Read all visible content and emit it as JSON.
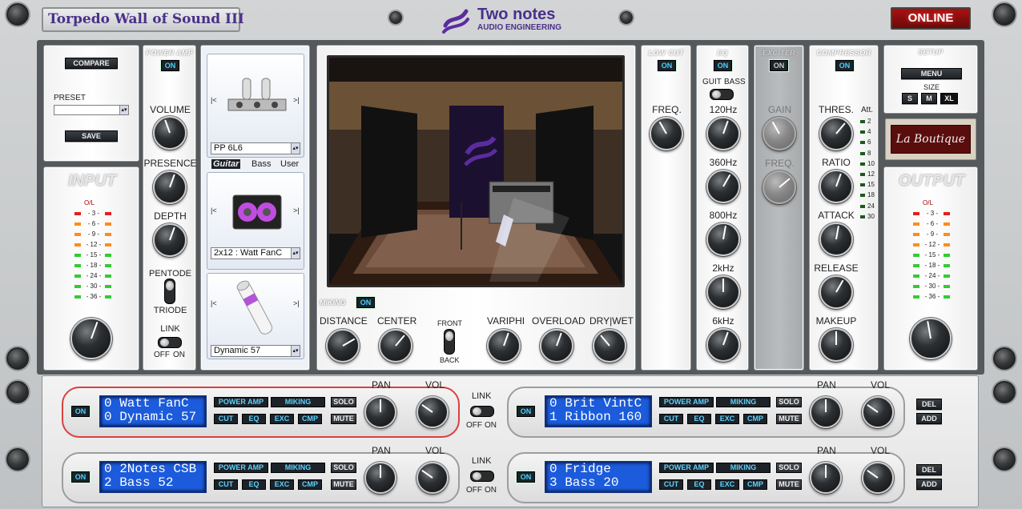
{
  "app": {
    "title": "Torpedo Wall of Sound III",
    "brand_line1": "Two notes",
    "brand_line2": "AUDIO ENGINEERING",
    "status": "ONLINE"
  },
  "colors": {
    "accent_blue": "#4ad2ff",
    "lcd_blue": "#1b5bdc",
    "online_red": "#c81e1e",
    "brand_purple": "#5b2ca0",
    "led_green": "#33cc33",
    "led_orange": "#ff8c1a",
    "led_red": "#e02020"
  },
  "preset": {
    "compare_label": "COMPARE",
    "preset_label": "PRESET",
    "preset_value": "",
    "save_label": "SAVE"
  },
  "input": {
    "title": "INPUT",
    "ol": "O/L",
    "scale": [
      "- 3 -",
      "- 6 -",
      "- 9 -",
      "- 12 -",
      "- 15 -",
      "- 18 -",
      "- 24 -",
      "- 30 -",
      "- 36 -"
    ]
  },
  "output": {
    "title": "OUTPUT",
    "ol": "O/L",
    "scale": [
      "- 3 -",
      "- 6 -",
      "- 9 -",
      "- 12 -",
      "- 15 -",
      "- 18 -",
      "- 24 -",
      "- 30 -",
      "- 36 -"
    ]
  },
  "power_amp": {
    "title": "POWER AMP",
    "on": "ON",
    "volume": "VOLUME",
    "presence": "PRESENCE",
    "depth": "DEPTH",
    "pentode": "PENTODE",
    "triode": "TRIODE",
    "link": "LINK",
    "off": "OFF",
    "on2": "ON"
  },
  "selectors": {
    "amp": {
      "value": "PP 6L6",
      "prev": "|<",
      "next": ">|"
    },
    "cab_tabs": [
      "Guitar",
      "Bass",
      "User"
    ],
    "cab": {
      "value": "2x12 : Watt FanC",
      "prev": "|<",
      "next": ">|"
    },
    "mic": {
      "value": "Dynamic 57",
      "prev": "|<",
      "next": ">|"
    }
  },
  "miking": {
    "title": "MIKING",
    "on": "ON",
    "distance": "DISTANCE",
    "center": "CENTER",
    "front": "FRONT",
    "back": "BACK",
    "variphi": "VARIPHI",
    "overload": "OVERLOAD",
    "drywet": "DRY|WET"
  },
  "low_cut": {
    "title": "LOW CUT",
    "on": "ON",
    "freq": "FREQ."
  },
  "eq": {
    "title": "EQ",
    "on": "ON",
    "guit": "GUIT",
    "bass": "BASS",
    "bands": [
      "120Hz",
      "360Hz",
      "800Hz",
      "2kHz",
      "6kHz"
    ]
  },
  "exciter": {
    "title": "EXCITER",
    "on": "ON",
    "gain": "GAIN",
    "freq": "FREQ."
  },
  "compressor": {
    "title": "COMPRESSOR",
    "on": "ON",
    "thres": "THRES.",
    "ratio": "RATIO",
    "attack": "ATTACK",
    "release": "RELEASE",
    "makeup": "MAKEUP",
    "att": "Att.",
    "att_scale": [
      "2",
      "4",
      "6",
      "8",
      "10",
      "12",
      "15",
      "18",
      "24",
      "30"
    ]
  },
  "setup": {
    "title": "SETUP",
    "menu": "MENU",
    "size": "SIZE",
    "sizes": [
      "S",
      "M",
      "XL"
    ],
    "logo": "La Boutique"
  },
  "slots": [
    {
      "on": "ON",
      "line1": "0 Watt FanC",
      "line2": "0 Dynamic 57",
      "power_amp": "POWER AMP",
      "miking": "MIKING",
      "solo": "SOLO",
      "cut": "CUT",
      "eq": "EQ",
      "exc": "EXC",
      "cmp": "CMP",
      "mute": "MUTE",
      "pan": "PAN",
      "vol": "VOL"
    },
    {
      "on": "ON",
      "line1": "0 Brit VintC",
      "line2": "1 Ribbon 160",
      "power_amp": "POWER AMP",
      "miking": "MIKING",
      "solo": "SOLO",
      "cut": "CUT",
      "eq": "EQ",
      "exc": "EXC",
      "cmp": "CMP",
      "mute": "MUTE",
      "pan": "PAN",
      "vol": "VOL",
      "del": "DEL",
      "add": "ADD"
    },
    {
      "on": "ON",
      "line1": "0 2Notes CSB",
      "line2": "2 Bass 52",
      "power_amp": "POWER AMP",
      "miking": "MIKING",
      "solo": "SOLO",
      "cut": "CUT",
      "eq": "EQ",
      "exc": "EXC",
      "cmp": "CMP",
      "mute": "MUTE",
      "pan": "PAN",
      "vol": "VOL"
    },
    {
      "on": "ON",
      "line1": "0 Fridge",
      "line2": "3 Bass 20",
      "power_amp": "POWER AMP",
      "miking": "MIKING",
      "solo": "SOLO",
      "cut": "CUT",
      "eq": "EQ",
      "exc": "EXC",
      "cmp": "CMP",
      "mute": "MUTE",
      "pan": "PAN",
      "vol": "VOL",
      "del": "DEL",
      "add": "ADD"
    }
  ],
  "links": [
    {
      "label": "LINK",
      "off": "OFF",
      "on": "ON"
    },
    {
      "label": "LINK",
      "off": "OFF",
      "on": "ON"
    }
  ]
}
